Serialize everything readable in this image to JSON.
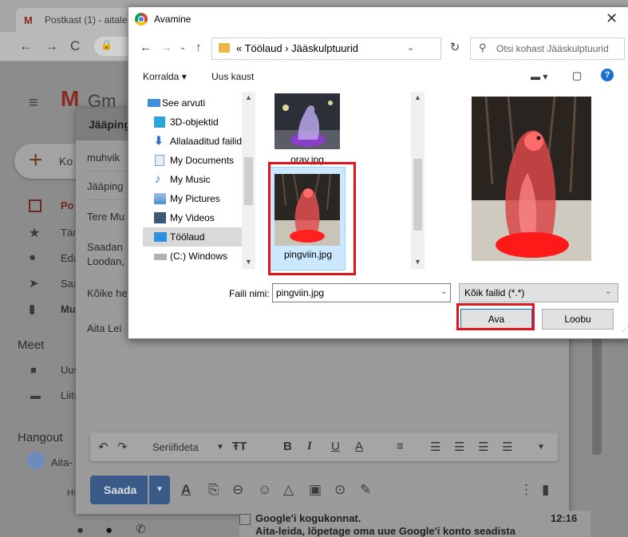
{
  "browser": {
    "tab_title": "Postkast (1) - aitale",
    "gmail_logo_text": "Gm"
  },
  "gmail": {
    "compose_label": "Ko",
    "nav": [
      {
        "label": "Po"
      },
      {
        "label": "Tär"
      },
      {
        "label": "Eda"
      },
      {
        "label": "Saa"
      },
      {
        "label": "Mu"
      }
    ],
    "meet_title": "Meet",
    "meet_items": [
      {
        "label": "Uus"
      },
      {
        "label": "Liitu"
      }
    ],
    "hangouts_title": "Hangout",
    "hangouts_user": "Aita-",
    "hangouts_hint": "Hi",
    "compose": {
      "title": "Jääping",
      "to": "muhvik",
      "subject": "Jääping",
      "body": [
        "Tere Mu",
        "Saadan",
        "Loodan,",
        "Kõike he",
        "Aita Lei"
      ],
      "font": "Seriifideta",
      "send_label": "Saada"
    },
    "inbox_row": {
      "sender": "Google'i kogukonnat.",
      "snippet": "Aita-leida, lõpetage oma uue Google'i konto seadista",
      "time": "12:16"
    }
  },
  "dialog": {
    "title": "Avamine",
    "path": "« Töölaud › Jääskulptuurid",
    "search_placeholder": "Otsi kohast Jääskulptuurid",
    "toolbar": {
      "organize": "Korralda ▾",
      "new_folder": "Uus kaust"
    },
    "tree": [
      {
        "label": "See arvuti",
        "icon": "computer-icon",
        "color": "#3c8fd8"
      },
      {
        "label": "3D-objektid",
        "icon": "3d-objects-icon",
        "color": "#2aa6d8"
      },
      {
        "label": "Allalaaditud failid",
        "icon": "download-icon",
        "color": "#2a6fd8"
      },
      {
        "label": "My Documents",
        "icon": "documents-icon",
        "color": "#8aa0b8"
      },
      {
        "label": "My Music",
        "icon": "music-icon",
        "color": "#1a7ad8"
      },
      {
        "label": "My Pictures",
        "icon": "pictures-icon",
        "color": "#4a90c8"
      },
      {
        "label": "My Videos",
        "icon": "videos-icon",
        "color": "#3a5a78"
      },
      {
        "label": "Töölaud",
        "icon": "desktop-icon",
        "color": "#2d8fe0"
      },
      {
        "label": "(C:) Windows",
        "icon": "drive-icon",
        "color": "#7a8a9a"
      }
    ],
    "selected_tree_index": 7,
    "files": [
      {
        "name": "orav.jpg"
      },
      {
        "name": "pingviin.jpg"
      }
    ],
    "file_name_label": "Faili nimi:",
    "file_name_value": "pingviin.jpg",
    "file_type": "Kõik failid (*.*)",
    "open_label": "Ava",
    "cancel_label": "Loobu",
    "highlight_color": "#e0151b"
  }
}
